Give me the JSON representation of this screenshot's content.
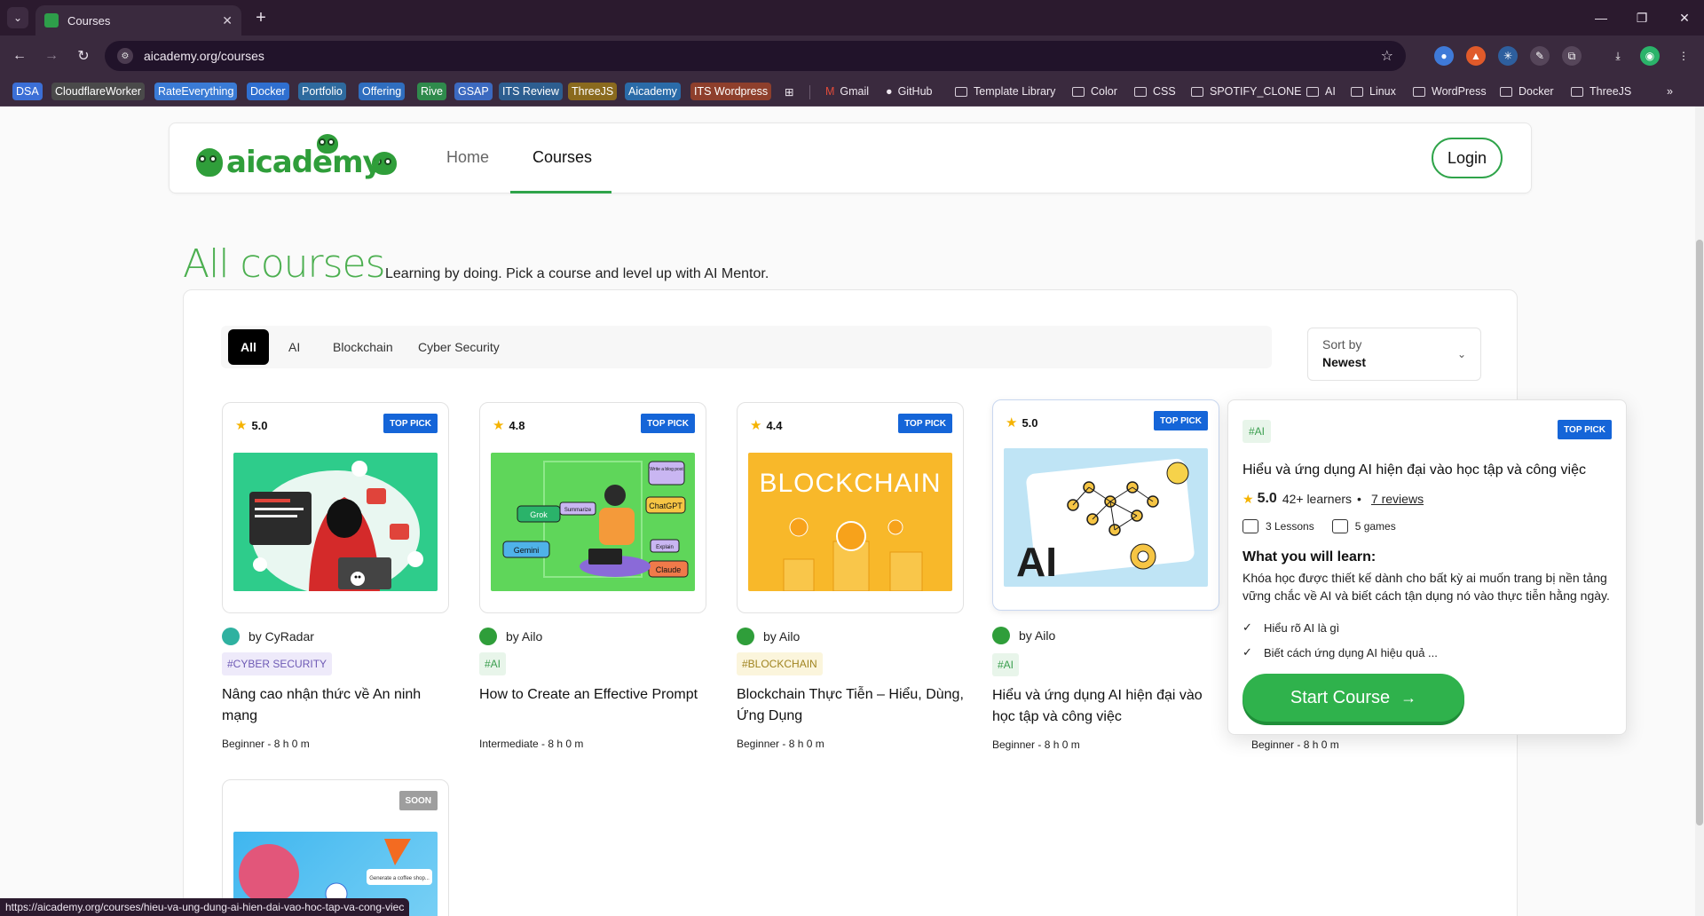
{
  "browser": {
    "tab_title": "Courses",
    "url": "aicademy.org/courses",
    "status_url": "https://aicademy.org/courses/hieu-va-ung-dung-ai-hien-dai-vao-hoc-tap-va-cong-viec",
    "bookmarks": [
      "DSA",
      "CloudflareWorker",
      "RateEverything",
      "Docker",
      "Portfolio",
      "Offering",
      "Rive",
      "GSAP",
      "ITS Review",
      "ThreeJS",
      "Aicademy",
      "ITS Wordpress"
    ],
    "bookmark_links": [
      "Gmail",
      "GitHub"
    ],
    "bookmark_folders": [
      "Template Library",
      "Color",
      "CSS",
      "SPOTIFY_CLONE",
      "AI",
      "Linux",
      "WordPress",
      "Docker",
      "ThreeJS"
    ],
    "bookmark_colors": {
      "DSA": "#3b6fd6",
      "CloudflareWorker": "#4a4a4a",
      "RateEverything": "#3a7bd5",
      "Docker": "#2f6fd0",
      "Portfolio": "#2e6a9e",
      "Offering": "#2f6ebf",
      "Rive": "#2f8a4c",
      "GSAP": "#3c6ac0",
      "ITS Review": "#2d5e90",
      "ThreeJS": "#8a6a1e",
      "Aicademy": "#2a6ba8",
      "ITS Wordpress": "#8e3f2c"
    }
  },
  "header": {
    "logo": "aicademy",
    "nav": {
      "home": "Home",
      "courses": "Courses"
    },
    "login": "Login"
  },
  "hero": {
    "title": "All courses",
    "subtitle": "Learning by doing. Pick a course and level up with AI Mentor."
  },
  "filters": {
    "chips": [
      "All",
      "AI",
      "Blockchain",
      "Cyber Security"
    ],
    "sort_label": "Sort by",
    "sort_value": "Newest"
  },
  "courses": [
    {
      "rating": "5.0",
      "badge": "TOP PICK",
      "author": "by CyRadar",
      "tag": "#CYBER SECURITY",
      "title": "Nâng cao nhận thức về An ninh mạng",
      "meta": "Beginner - 8 h 0 m"
    },
    {
      "rating": "4.8",
      "badge": "TOP PICK",
      "author": "by Ailo",
      "tag": "#AI",
      "title": "How to Create an Effective Prompt",
      "meta": "Intermediate - 8 h 0 m"
    },
    {
      "rating": "4.4",
      "badge": "TOP PICK",
      "author": "by Ailo",
      "tag": "#BLOCKCHAIN",
      "title": "Blockchain Thực Tiễn – Hiểu, Dùng, Ứng Dụng",
      "meta": "Beginner - 8 h 0 m"
    },
    {
      "rating": "5.0",
      "badge": "TOP PICK",
      "author": "by Ailo",
      "tag": "#AI",
      "title": "Hiểu và ứng dụng AI hiện đại vào học tập và công việc",
      "meta": "Beginner - 8 h 0 m"
    },
    {
      "meta": "Beginner - 8 h 0 m"
    },
    {
      "badge": "SOON"
    }
  ],
  "thumb_text": {
    "blockchain": "BLOCKCHAIN",
    "ai": "AI",
    "prompt_bubbles": [
      "Grok",
      "Gemini",
      "ChatGPT",
      "Claude",
      "Summarize",
      "Explain",
      "Write a blog post"
    ],
    "soon_bubble": "Generate a coffee shop..."
  },
  "popover": {
    "tag": "#AI",
    "badge": "TOP PICK",
    "title": "Hiểu và ứng dụng AI hiện đại vào học tập và công việc",
    "rating": "5.0",
    "learners": "42+ learners",
    "dot": "•",
    "reviews": "7 reviews",
    "lessons": "3 Lessons",
    "games": "5 games",
    "learn_heading": "What you will learn:",
    "learn_desc": "Khóa học được thiết kế dành cho bất kỳ ai muốn trang bị nền tảng vững chắc về AI và biết cách tận dụng nó vào thực tiễn hằng ngày.",
    "learn_points": [
      "Hiểu rõ AI là gì",
      "Biết cách ứng dụng AI hiệu quả ..."
    ],
    "cta": "Start Course"
  }
}
